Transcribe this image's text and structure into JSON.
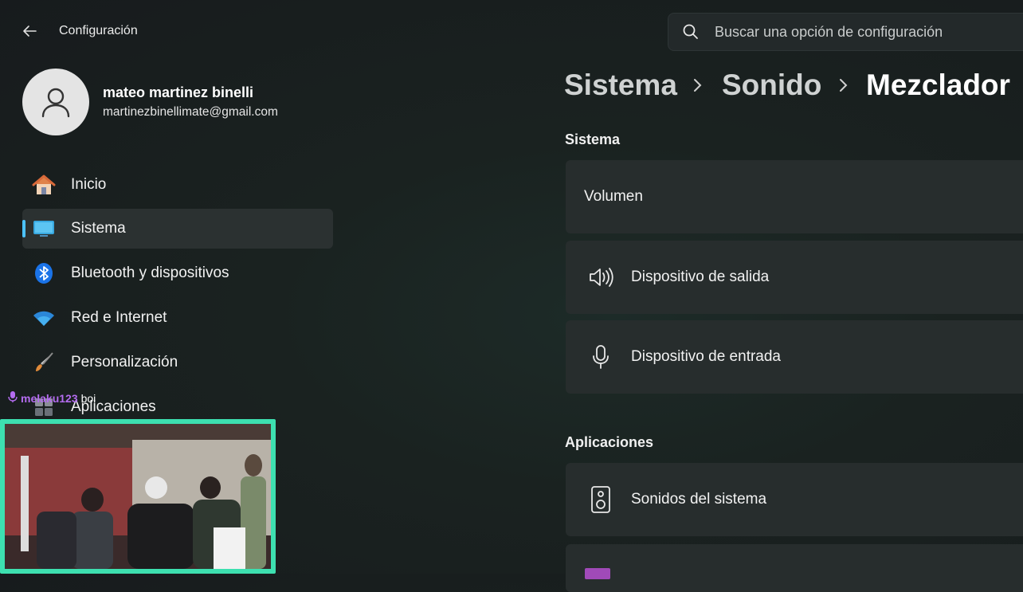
{
  "window": {
    "title": "Configuración"
  },
  "search": {
    "placeholder": "Buscar una opción de configuración"
  },
  "account": {
    "name": "mateo martinez binelli",
    "email": "martinezbinellimate@gmail.com"
  },
  "sidebar": {
    "items": [
      {
        "label": "Inicio",
        "icon": "home-icon",
        "selected": false
      },
      {
        "label": "Sistema",
        "icon": "monitor-icon",
        "selected": true
      },
      {
        "label": "Bluetooth y dispositivos",
        "icon": "bluetooth-icon",
        "selected": false
      },
      {
        "label": "Red e Internet",
        "icon": "wifi-icon",
        "selected": false
      },
      {
        "label": "Personalización",
        "icon": "brush-icon",
        "selected": false
      },
      {
        "label": "Aplicaciones",
        "icon": "apps-icon",
        "selected": false
      }
    ]
  },
  "breadcrumb": {
    "items": [
      "Sistema",
      "Sonido",
      "Mezclador"
    ]
  },
  "main": {
    "sections": [
      {
        "title": "Sistema",
        "cards": [
          {
            "label": "Volumen",
            "icon": ""
          },
          {
            "label": "Dispositivo de salida",
            "icon": "speaker-icon"
          },
          {
            "label": "Dispositivo de entrada",
            "icon": "microphone-icon"
          }
        ]
      },
      {
        "title": "Aplicaciones",
        "cards": [
          {
            "label": "Sonidos del sistema",
            "icon": "system-sounds-icon"
          }
        ]
      }
    ]
  },
  "overlay": {
    "chat_user": "melaku123",
    "chat_message": "boi"
  },
  "colors": {
    "accent": "#4cc2ff",
    "card_bg": "#272d2d",
    "selected_bg": "#2b3131",
    "webcam_border": "#3de0b0",
    "chat_user": "#b46cf0"
  }
}
